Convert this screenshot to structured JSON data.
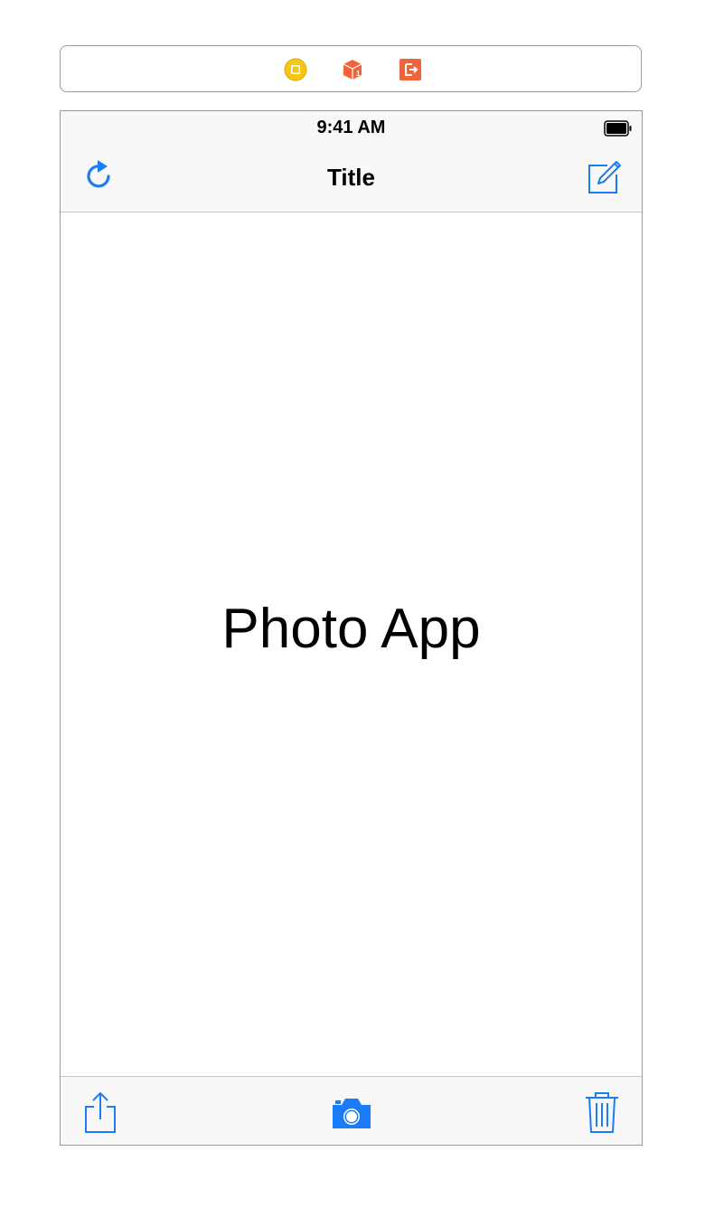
{
  "scene_dock": {
    "icons": [
      "view-controller-icon",
      "first-responder-icon",
      "exit-icon"
    ]
  },
  "status_bar": {
    "time": "9:41 AM"
  },
  "nav_bar": {
    "title": "Title",
    "left_button_icon": "refresh-icon",
    "right_button_icon": "compose-icon"
  },
  "content": {
    "label": "Photo App"
  },
  "toolbar": {
    "items": [
      "share-icon",
      "camera-icon",
      "trash-icon"
    ]
  },
  "colors": {
    "tint": "#1a7cf6",
    "bar_background": "#f8f8f8",
    "view_controller_yellow": "#f5c518",
    "first_responder_orange": "#f0643c",
    "exit_orange": "#f0643c"
  }
}
